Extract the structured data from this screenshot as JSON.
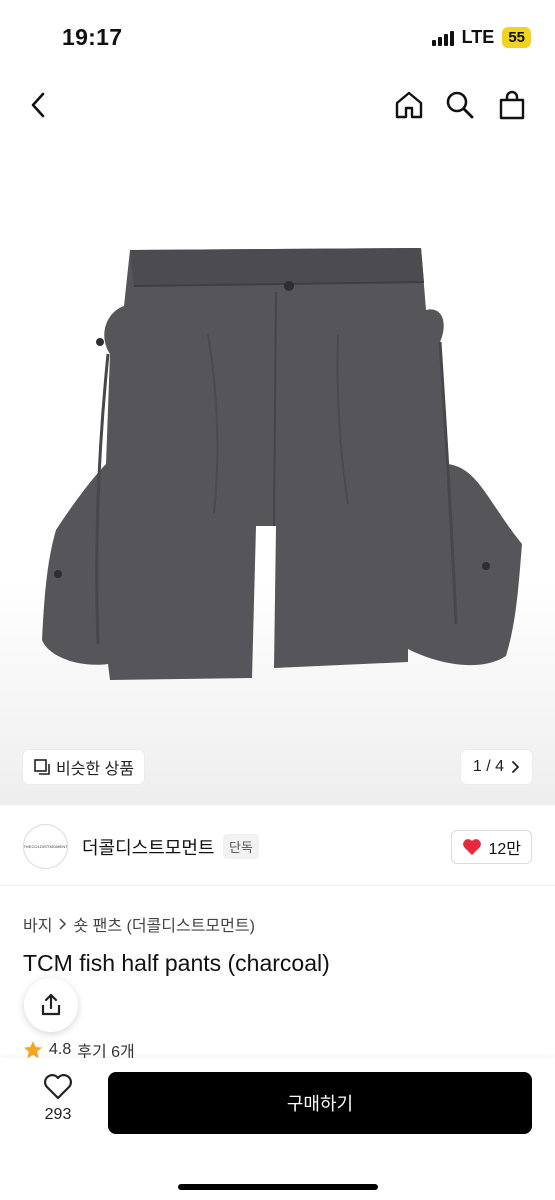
{
  "status": {
    "time": "19:17",
    "network": "LTE",
    "battery": "55"
  },
  "nav": {
    "back_icon": "chevron-left-icon",
    "home_icon": "home-icon",
    "search_icon": "search-icon",
    "bag_icon": "shopping-bag-icon"
  },
  "gallery": {
    "similar_label": "비슷한 상품",
    "page_indicator": "1 / 4"
  },
  "brand": {
    "logo_text": "THECOLDISTMOMENT",
    "name": "더콜디스트모먼트",
    "badge": "단독",
    "like_count": "12만"
  },
  "product": {
    "breadcrumb": [
      "바지",
      "숏 팬츠 (더콜디스트모먼트)"
    ],
    "title": "TCM fish half pants (charcoal)",
    "rating": "4.8",
    "review_label": "후기 6개"
  },
  "bottom": {
    "wish_count": "293",
    "buy_label": "구매하기"
  },
  "colors": {
    "accent": "#000000",
    "heart": "#e8283c",
    "star": "#f5a623",
    "battery": "#f4d31e",
    "product": "#55555a"
  }
}
